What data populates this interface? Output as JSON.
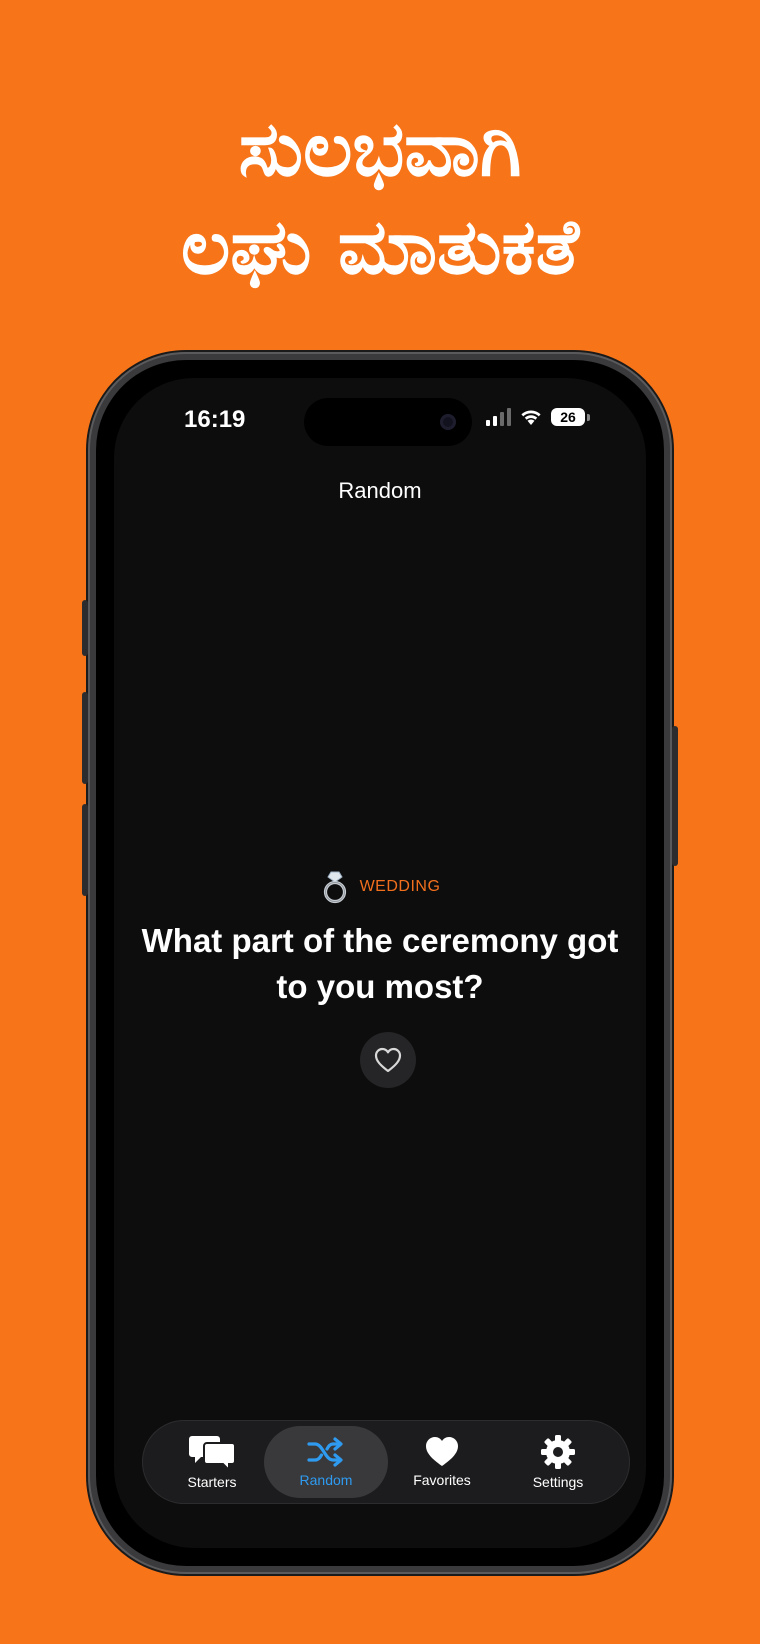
{
  "headline": {
    "line1": "ಸುಲಭವಾಗಿ",
    "line2": "ಲಘು ಮಾತುಕತೆ"
  },
  "status_bar": {
    "time": "16:19",
    "battery": "26"
  },
  "nav": {
    "title": "Random"
  },
  "card": {
    "category_icon": "ring-icon",
    "category": "WEDDING",
    "question": "What part of the ceremony got to you most?"
  },
  "tabs": [
    {
      "label": "Starters",
      "icon": "chat-bubbles-icon",
      "active": false
    },
    {
      "label": "Random",
      "icon": "shuffle-icon",
      "active": true
    },
    {
      "label": "Favorites",
      "icon": "heart-icon",
      "active": false
    },
    {
      "label": "Settings",
      "icon": "gear-icon",
      "active": false
    }
  ],
  "colors": {
    "background": "#F87418",
    "accent_category": "#F26F1D",
    "accent_active_tab": "#2F9BF0",
    "screen": "#0D0D0D"
  }
}
